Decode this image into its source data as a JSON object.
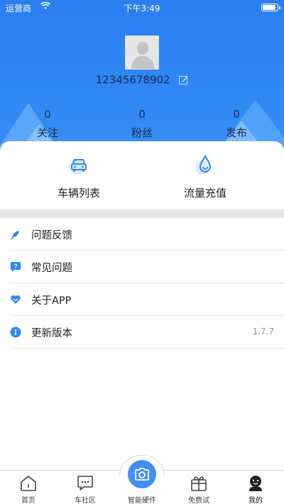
{
  "status_bar": {
    "carrier": "运营商",
    "time": "下午3:49",
    "battery_level": 0.9
  },
  "profile": {
    "phone": "12345678902"
  },
  "stats": [
    {
      "value": "0",
      "label": "关注"
    },
    {
      "value": "0",
      "label": "粉丝"
    },
    {
      "value": "0",
      "label": "发布"
    }
  ],
  "quick_actions": [
    {
      "label": "车辆列表",
      "icon": "car-icon"
    },
    {
      "label": "流量充值",
      "icon": "water-drop-icon"
    }
  ],
  "menu": [
    {
      "label": "问题反馈",
      "icon": "pen-feedback-icon",
      "value": ""
    },
    {
      "label": "常见问题",
      "icon": "question-bubble-icon",
      "value": ""
    },
    {
      "label": "关于APP",
      "icon": "heart-icon",
      "value": ""
    },
    {
      "label": "更新版本",
      "icon": "info-icon",
      "value": "1.7.7"
    }
  ],
  "tabs": [
    {
      "label": "首页",
      "icon": "home-icon"
    },
    {
      "label": "车社区",
      "icon": "chat-bubble-icon"
    },
    {
      "label": "智能硬件",
      "icon": "camera-icon"
    },
    {
      "label": "免费试",
      "icon": "gift-icon"
    },
    {
      "label": "我的",
      "icon": "user-icon",
      "active": true
    }
  ],
  "colors": {
    "primary": "#2f86f5",
    "accent_blue": "#3f8ff5",
    "text": "#222222"
  }
}
